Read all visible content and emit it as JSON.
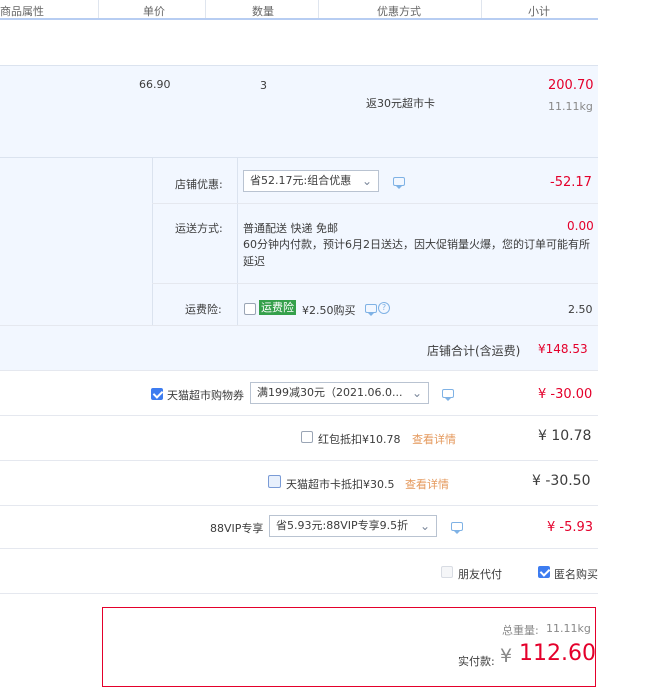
{
  "table_header": {
    "attr": "商品属性",
    "price": "单价",
    "qty": "数量",
    "promo": "优惠方式",
    "subtotal": "小计"
  },
  "item": {
    "price": "66.90",
    "qty": "3",
    "promo": "返30元超市卡",
    "subtotal": "200.70",
    "weight": "11.11kg"
  },
  "shop_discount": {
    "label": "店铺优惠:",
    "value": "省52.17元:组合优惠",
    "amount": "-52.17"
  },
  "shipping": {
    "label": "运送方式:",
    "method": "普通配送 快递 免邮",
    "amount": "0.00",
    "note": "60分钟内付款，预计6月2日送达，因大促销量火爆，您的订单可能有所延迟"
  },
  "insurance": {
    "label": "运费险:",
    "badge": "运费险",
    "price": "¥2.50购买",
    "amount": "2.50"
  },
  "shop_total": {
    "label": "店铺合计(含运费)",
    "amount": "¥148.53"
  },
  "coupon": {
    "label": "天猫超市购物券",
    "value": "满199减30元（2021.06.0...",
    "amount": "¥ -30.00"
  },
  "redpacket": {
    "label": "红包抵扣¥10.78",
    "link": "查看详情",
    "amount": "¥ 10.78"
  },
  "card": {
    "label": "天猫超市卡抵扣¥30.5",
    "link": "查看详情",
    "amount": "¥ -30.50"
  },
  "vip": {
    "label": "88VIP专享",
    "value": "省5.93元:88VIP专享9.5折",
    "amount": "¥ -5.93"
  },
  "options": {
    "friend_pay": "朋友代付",
    "anonymous": "匿名购买"
  },
  "summary": {
    "weight_label": "总重量:",
    "weight": "11.11kg",
    "pay_label": "实付款:",
    "currency": "¥",
    "amount": "112.60"
  },
  "colors": {
    "accent_red": "#e4002b",
    "blue_bg": "#f2f7ff",
    "link_orange": "#e4985b",
    "checkbox_blue": "#3d7cf0"
  }
}
